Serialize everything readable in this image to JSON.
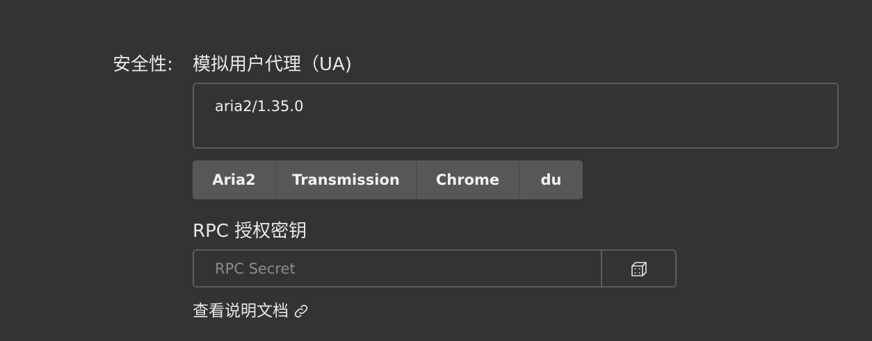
{
  "security": {
    "section_label": "安全性:"
  },
  "user_agent": {
    "title": "模拟用户代理（UA)",
    "value": "aria2/1.35.0",
    "presets": [
      "Aria2",
      "Transmission",
      "Chrome",
      "du"
    ]
  },
  "rpc_secret": {
    "title": "RPC 授权密钥",
    "placeholder": "RPC Secret",
    "value": "",
    "generate_icon": "dice-icon"
  },
  "docs_link": {
    "label": "查看说明文档",
    "icon": "external-link-icon"
  },
  "colors": {
    "background": "#333333",
    "border": "#5c5c5c",
    "button_bg": "#575757",
    "text": "#e8e8e8",
    "placeholder": "#8c8c8c"
  }
}
